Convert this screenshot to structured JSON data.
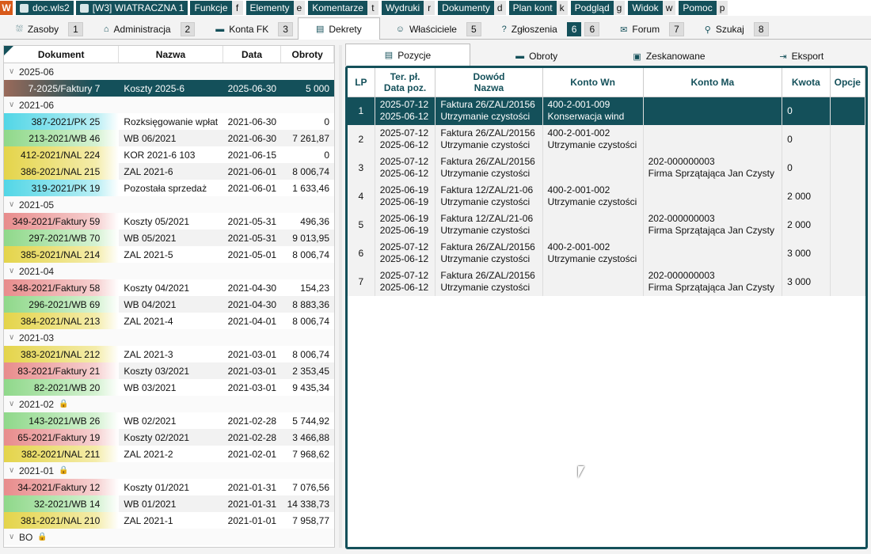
{
  "menubar": {
    "app_icon": "app-logo-icon",
    "file_label": "doc.wls2",
    "company_label": "[W3] WIATRACZNA 1",
    "items": [
      {
        "label": "Funkcje",
        "key": "f"
      },
      {
        "label": "Elementy",
        "key": "e"
      },
      {
        "label": "Komentarze",
        "key": "t"
      },
      {
        "label": "Wydruki",
        "key": "r"
      },
      {
        "label": "Dokumenty",
        "key": "d"
      },
      {
        "label": "Plan kont",
        "key": "k"
      },
      {
        "label": "Podgląd",
        "key": "g"
      },
      {
        "label": "Widok",
        "key": "w"
      },
      {
        "label": "Pomoc",
        "key": "p"
      }
    ]
  },
  "tabs": [
    {
      "label": "Zasoby",
      "key": "1",
      "icon": "⛆"
    },
    {
      "label": "Administracja",
      "key": "2",
      "icon": "⌂"
    },
    {
      "label": "Konta FK",
      "key": "3",
      "icon": "▬"
    },
    {
      "label": "Dekrety",
      "key": "",
      "icon": "▤"
    },
    {
      "label": "Właściciele",
      "key": "5",
      "icon": "☺"
    },
    {
      "label": "Zgłoszenia",
      "key": "6",
      "icon": "?"
    },
    {
      "label": "Forum",
      "key": "7",
      "icon": "✉"
    },
    {
      "label": "Szukaj",
      "key": "8",
      "icon": "⚲"
    }
  ],
  "tab_extra_key": "6",
  "left": {
    "columns": [
      "Dokument",
      "Nazwa",
      "Data",
      "Obroty"
    ],
    "groups": [
      {
        "label": "2025-06",
        "locked": false,
        "rows": [
          {
            "doc": "7-2025/Faktury 7",
            "name": "Koszty 2025-6",
            "date": "2025-06-30",
            "amount": "5 000",
            "color": "brown",
            "selected": true
          }
        ]
      },
      {
        "label": "2021-06",
        "locked": false,
        "rows": [
          {
            "doc": "387-2021/PK 25",
            "name": "Rozksięgowanie wpłat",
            "date": "2021-06-30",
            "amount": "0",
            "color": "cyan"
          },
          {
            "doc": "213-2021/WB 46",
            "name": "WB 06/2021",
            "date": "2021-06-30",
            "amount": "7 261,87",
            "color": "green"
          },
          {
            "doc": "412-2021/NAL 224",
            "name": "KOR 2021-6 103",
            "date": "2021-06-15",
            "amount": "0",
            "color": "yellow"
          },
          {
            "doc": "386-2021/NAL 215",
            "name": "ZAL 2021-6",
            "date": "2021-06-01",
            "amount": "8 006,74",
            "color": "yellow"
          },
          {
            "doc": "319-2021/PK 19",
            "name": "Pozostała sprzedaż",
            "date": "2021-06-01",
            "amount": "1 633,46",
            "color": "cyan"
          }
        ]
      },
      {
        "label": "2021-05",
        "locked": false,
        "rows": [
          {
            "doc": "349-2021/Faktury 59",
            "name": "Koszty 05/2021",
            "date": "2021-05-31",
            "amount": "496,36",
            "color": "red"
          },
          {
            "doc": "297-2021/WB 70",
            "name": "WB 05/2021",
            "date": "2021-05-31",
            "amount": "9 013,95",
            "color": "green"
          },
          {
            "doc": "385-2021/NAL 214",
            "name": "ZAL 2021-5",
            "date": "2021-05-01",
            "amount": "8 006,74",
            "color": "yellow"
          }
        ]
      },
      {
        "label": "2021-04",
        "locked": false,
        "rows": [
          {
            "doc": "348-2021/Faktury 58",
            "name": "Koszty 04/2021",
            "date": "2021-04-30",
            "amount": "154,23",
            "color": "red"
          },
          {
            "doc": "296-2021/WB 69",
            "name": "WB 04/2021",
            "date": "2021-04-30",
            "amount": "8 883,36",
            "color": "green"
          },
          {
            "doc": "384-2021/NAL 213",
            "name": "ZAL 2021-4",
            "date": "2021-04-01",
            "amount": "8 006,74",
            "color": "yellow"
          }
        ]
      },
      {
        "label": "2021-03",
        "locked": false,
        "rows": [
          {
            "doc": "383-2021/NAL 212",
            "name": "ZAL 2021-3",
            "date": "2021-03-01",
            "amount": "8 006,74",
            "color": "yellow"
          },
          {
            "doc": "83-2021/Faktury 21",
            "name": "Koszty 03/2021",
            "date": "2021-03-01",
            "amount": "2 353,45",
            "color": "red"
          },
          {
            "doc": "82-2021/WB 20",
            "name": "WB 03/2021",
            "date": "2021-03-01",
            "amount": "9 435,34",
            "color": "green"
          }
        ]
      },
      {
        "label": "2021-02",
        "locked": true,
        "rows": [
          {
            "doc": "143-2021/WB 26",
            "name": "WB 02/2021",
            "date": "2021-02-28",
            "amount": "5 744,92",
            "color": "green"
          },
          {
            "doc": "65-2021/Faktury 19",
            "name": "Koszty 02/2021",
            "date": "2021-02-28",
            "amount": "3 466,88",
            "color": "red"
          },
          {
            "doc": "382-2021/NAL 211",
            "name": "ZAL 2021-2",
            "date": "2021-02-01",
            "amount": "7 968,62",
            "color": "yellow"
          }
        ]
      },
      {
        "label": "2021-01",
        "locked": true,
        "rows": [
          {
            "doc": "34-2021/Faktury 12",
            "name": "Koszty 01/2021",
            "date": "2021-01-31",
            "amount": "7 076,56",
            "color": "red"
          },
          {
            "doc": "32-2021/WB 14",
            "name": "WB 01/2021",
            "date": "2021-01-31",
            "amount": "14 338,73",
            "color": "green"
          },
          {
            "doc": "381-2021/NAL 210",
            "name": "ZAL 2021-1",
            "date": "2021-01-01",
            "amount": "7 958,77",
            "color": "yellow"
          }
        ]
      },
      {
        "label": "BO",
        "locked": true,
        "rows": []
      }
    ]
  },
  "subtabs": [
    {
      "label": "Pozycje",
      "icon": "▤"
    },
    {
      "label": "Obroty",
      "icon": "▬"
    },
    {
      "label": "Zeskanowane",
      "icon": "▣"
    },
    {
      "label": "Eksport",
      "icon": "⇥"
    }
  ],
  "positions": {
    "headers": {
      "lp": "LP",
      "ter": "Ter. pł.",
      "data": "Data poz.",
      "dowod": "Dowód",
      "nazwa": "Nazwa",
      "wn": "Konto Wn",
      "ma": "Konto Ma",
      "kwota": "Kwota",
      "opcje": "Opcje"
    },
    "rows": [
      {
        "lp": "1",
        "ter": "2025-07-12",
        "data": "2025-06-12",
        "dowod": "Faktura 26/ZAL/20156",
        "nazwa": "Utrzymanie czystości",
        "wn1": "400-2-001-009",
        "wn2": "Konserwacja wind",
        "ma1": "",
        "ma2": "",
        "kwota": "0",
        "selected": true
      },
      {
        "lp": "2",
        "ter": "2025-07-12",
        "data": "2025-06-12",
        "dowod": "Faktura 26/ZAL/20156",
        "nazwa": "Utrzymanie czystości",
        "wn1": "400-2-001-002",
        "wn2": "Utrzymanie czystości",
        "ma1": "",
        "ma2": "",
        "kwota": "0"
      },
      {
        "lp": "3",
        "ter": "2025-07-12",
        "data": "2025-06-12",
        "dowod": "Faktura 26/ZAL/20156",
        "nazwa": "Utrzymanie czystości",
        "wn1": "",
        "wn2": "",
        "ma1": "202-000000003",
        "ma2": "Firma Sprzątająca Jan Czysty",
        "kwota": "0"
      },
      {
        "lp": "4",
        "ter": "2025-06-19",
        "data": "2025-06-19",
        "dowod": "Faktura 12/ZAL/21-06",
        "nazwa": "Utrzymanie czystości",
        "wn1": "400-2-001-002",
        "wn2": "Utrzymanie czystości",
        "ma1": "",
        "ma2": "",
        "kwota": "2 000"
      },
      {
        "lp": "5",
        "ter": "2025-06-19",
        "data": "2025-06-19",
        "dowod": "Faktura 12/ZAL/21-06",
        "nazwa": "Utrzymanie czystości",
        "wn1": "",
        "wn2": "",
        "ma1": "202-000000003",
        "ma2": "Firma Sprzątająca Jan Czysty",
        "kwota": "2 000"
      },
      {
        "lp": "6",
        "ter": "2025-07-12",
        "data": "2025-06-12",
        "dowod": "Faktura 26/ZAL/20156",
        "nazwa": "Utrzymanie czystości",
        "wn1": "400-2-001-002",
        "wn2": "Utrzymanie czystości",
        "ma1": "",
        "ma2": "",
        "kwota": "3 000"
      },
      {
        "lp": "7",
        "ter": "2025-07-12",
        "data": "2025-06-12",
        "dowod": "Faktura 26/ZAL/20156",
        "nazwa": "Utrzymanie czystości",
        "wn1": "",
        "wn2": "",
        "ma1": "202-000000003",
        "ma2": "Firma Sprzątająca Jan Czysty",
        "kwota": "3 000"
      }
    ]
  },
  "colors": {
    "accent": "#14505a",
    "brand": "#d85a1a"
  }
}
